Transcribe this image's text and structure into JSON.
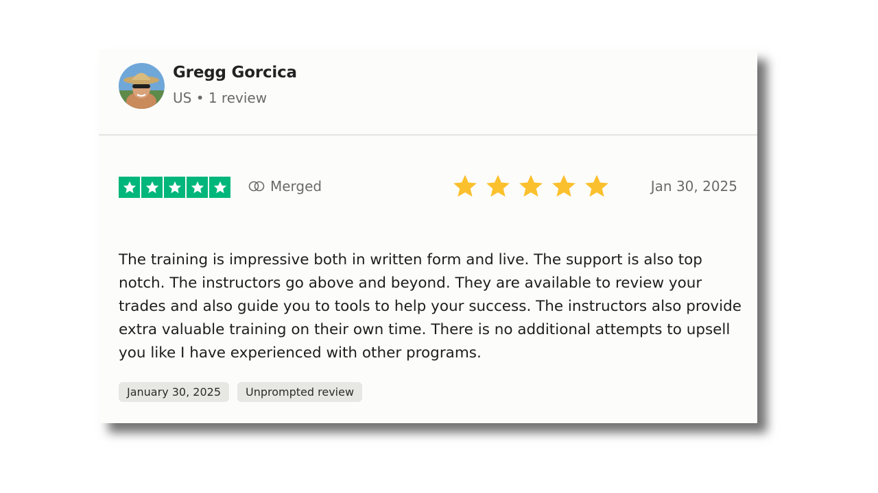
{
  "reviewer": {
    "name": "Gregg Gorcica",
    "meta": "US • 1 review"
  },
  "rating": {
    "stars": 5,
    "source_label": "Merged",
    "date": "Jan 30, 2025",
    "badge_color": "#00b67a",
    "star_color": "#fbc02d"
  },
  "review": {
    "text": "The training is impressive both in written form and live. The support is also top notch. The instructors go above and beyond. They are available to review your trades and also guide you to tools to help your success. The instructors also provide extra valuable training on their own time. There is no additional attempts to upsell you like I have experienced with other programs."
  },
  "tags": [
    {
      "label": "January 30, 2025"
    },
    {
      "label": "Unprompted review"
    }
  ]
}
